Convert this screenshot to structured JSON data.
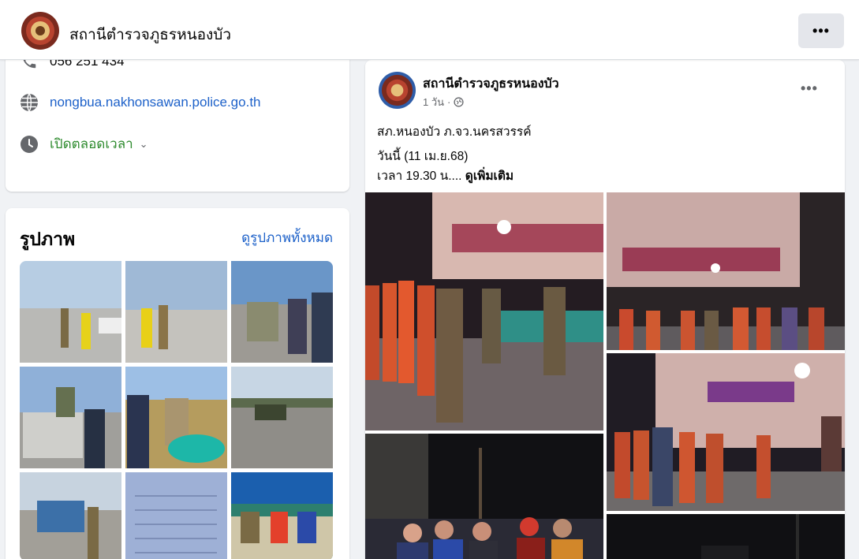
{
  "header": {
    "page_name": "สถานีตำรวจภูธรหนองบัว",
    "more_label": "•••"
  },
  "intro": {
    "phone": "056 251 434",
    "website": "nongbua.nakhonsawan.police.go.th",
    "hours": "เปิดตลอดเวลา",
    "hours_caret": "⌄"
  },
  "photos": {
    "title": "รูปภาพ",
    "see_all": "ดูรูปภาพทั้งหมด",
    "count": 9
  },
  "post": {
    "author": "สถานีตำรวจภูธรหนองบัว",
    "time": "1 วัน",
    "separator": "·",
    "privacy_icon": "globe-icon",
    "more_label": "•••",
    "line1": "สภ.หนองบัว ภ.จว.นครสวรรค์",
    "line2": "วันนี้ (11 เม.ย.68)",
    "line3": "เวลา 19.30 น....",
    "see_more": "ดูเพิ่มเติม"
  },
  "colors": {
    "link": "#1d61c9",
    "open_status": "#2d8a2d",
    "background": "#f0f2f5",
    "card": "#ffffff"
  }
}
